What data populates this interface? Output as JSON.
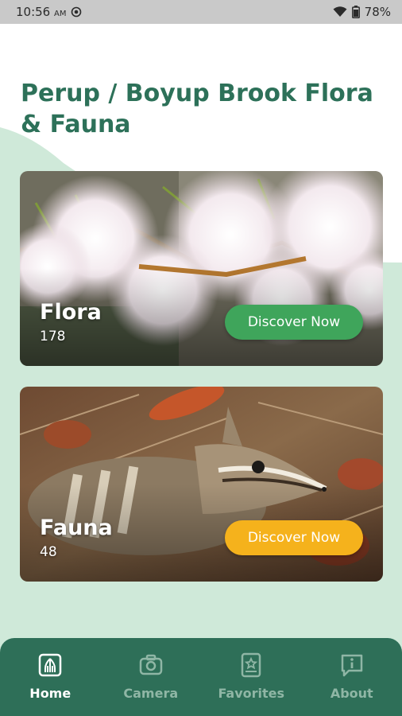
{
  "status_bar": {
    "time": "10:56",
    "ampm": "AM",
    "battery": "78%",
    "icons": [
      "record-icon",
      "wifi-icon",
      "battery-icon"
    ]
  },
  "page": {
    "title": "Perup / Boyup Brook Flora & Fauna"
  },
  "cards": [
    {
      "title": "Flora",
      "count": "178",
      "button": "Discover Now",
      "button_color": "#3fa55b"
    },
    {
      "title": "Fauna",
      "count": "48",
      "button": "Discover Now",
      "button_color": "#f5b21c"
    }
  ],
  "bottom_nav": {
    "items": [
      {
        "label": "Home",
        "icon": "home-icon",
        "active": true
      },
      {
        "label": "Camera",
        "icon": "camera-icon",
        "active": false
      },
      {
        "label": "Favorites",
        "icon": "favorites-icon",
        "active": false
      },
      {
        "label": "About",
        "icon": "about-icon",
        "active": false
      }
    ]
  },
  "colors": {
    "accent": "#2d7159",
    "nav_bg": "#2e6f58",
    "background_tint": "#cfe9d9"
  }
}
